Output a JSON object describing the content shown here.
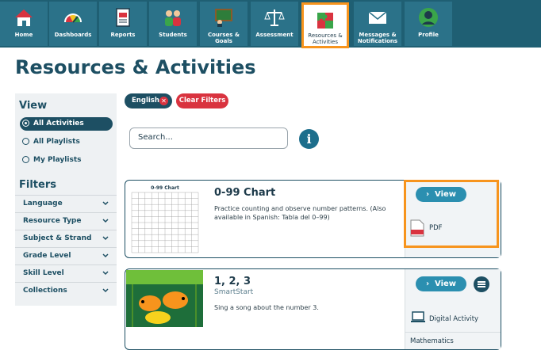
{
  "nav": {
    "items": [
      {
        "label": "Home",
        "icon": "home-icon"
      },
      {
        "label": "Dashboards",
        "icon": "dashboard-gauge-icon"
      },
      {
        "label": "Reports",
        "icon": "reports-icon"
      },
      {
        "label": "Students",
        "icon": "students-icon"
      },
      {
        "label": "Courses & Goals",
        "icon": "courses-icon"
      },
      {
        "label": "Assessment",
        "icon": "scale-icon"
      },
      {
        "label": "Resources &",
        "label2": "Activities",
        "icon": "puzzle-icon"
      },
      {
        "label": "Messages &",
        "label2": "Notifications",
        "icon": "envelope-icon"
      },
      {
        "label": "Profile",
        "icon": "profile-icon"
      }
    ],
    "active": "Resources & Activities"
  },
  "page_title": "Resources & Activities",
  "filters_chips": {
    "language": "English",
    "clear": "Clear Filters"
  },
  "sidebar": {
    "view_heading": "View",
    "views": [
      "All Activities",
      "All Playlists",
      "My Playlists"
    ],
    "filters_heading": "Filters",
    "filters": [
      "Language",
      "Resource Type",
      "Subject & Strand",
      "Grade Level",
      "Skill Level",
      "Collections"
    ]
  },
  "search": {
    "placeholder": "Search..."
  },
  "cards": [
    {
      "title": "0-99 Chart",
      "desc1": "Practice counting and observe number patterns. (Also",
      "desc2": "available in Spanish: Tabla del 0–99)",
      "view_label": "View",
      "type_label": "PDF",
      "thumb_title": "0-99 Chart"
    },
    {
      "title": "1, 2, 3",
      "subtitle": "SmartStart",
      "desc1": "Sing a song about the number 3.",
      "view_label": "View",
      "type_label": "Digital Activity",
      "subject_label": "Mathematics"
    }
  ],
  "colors": {
    "nav_bg": "#1f5f73",
    "accent": "#f7941d",
    "danger": "#d9333f",
    "primary": "#2b8fb0"
  }
}
